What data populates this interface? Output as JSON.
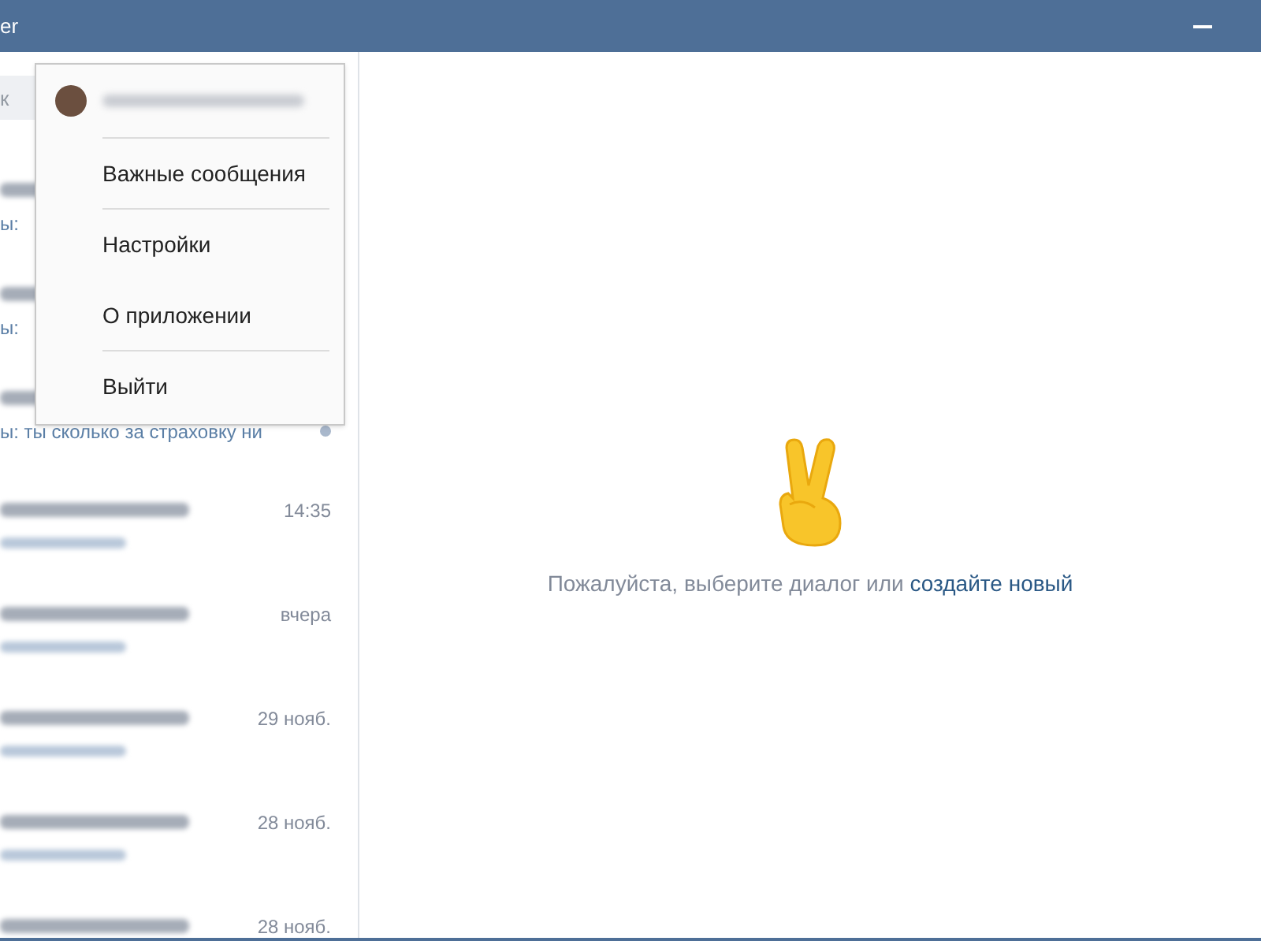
{
  "window": {
    "title": "er"
  },
  "search": {
    "placeholder": "к"
  },
  "dialogs": [
    {
      "preview": "ы:",
      "unread": false
    },
    {
      "preview": "ы:",
      "unread": false
    },
    {
      "preview": "ы: ты сколько за страховку ни",
      "unread": true
    },
    {
      "time": "14:35",
      "unread": false
    },
    {
      "time": "вчера",
      "unread": false
    },
    {
      "time": "29 нояб.",
      "unread": false
    },
    {
      "time": "28 нояб.",
      "unread": false
    },
    {
      "time": "28 нояб.",
      "unread": false
    }
  ],
  "menu": {
    "items": [
      {
        "label": "Важные сообщения",
        "divider_above": true
      },
      {
        "label": "Настройки",
        "divider_above": true
      },
      {
        "label": "О приложении",
        "divider_above": false
      },
      {
        "label": "Выйти",
        "divider_above": true
      }
    ]
  },
  "empty_state": {
    "message": "Пожалуйста, выберите диалог или ",
    "link": "создайте новый"
  }
}
